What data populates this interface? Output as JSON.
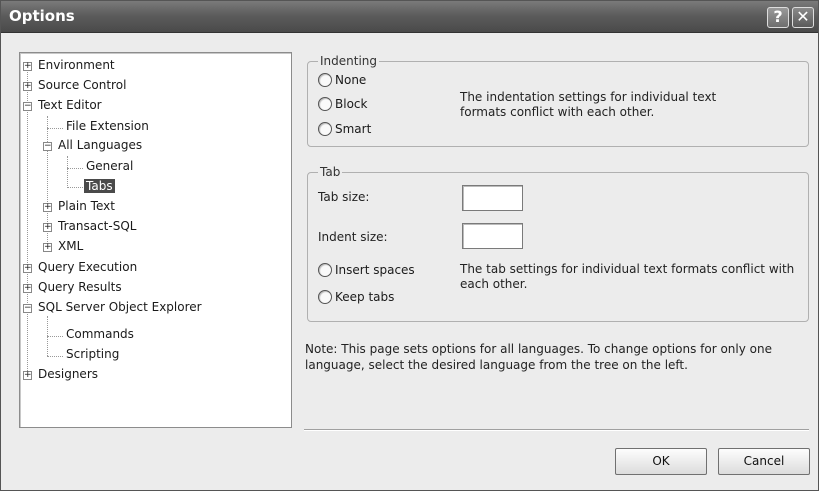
{
  "window": {
    "title": "Options",
    "help_glyph": "?",
    "close_glyph": "✕"
  },
  "tree": {
    "environment": "Environment",
    "source_control": "Source Control",
    "text_editor": "Text Editor",
    "file_extension": "File Extension",
    "all_languages": "All Languages",
    "general": "General",
    "tabs": "Tabs",
    "plain_text": "Plain Text",
    "transact_sql": "Transact-SQL",
    "xml": "XML",
    "query_execution": "Query Execution",
    "query_results": "Query Results",
    "sql_server_object_explorer": "SQL Server Object Explorer",
    "commands": "Commands",
    "scripting": "Scripting",
    "designers": "Designers",
    "selected": "Tabs"
  },
  "indenting": {
    "title": "Indenting",
    "none": "None",
    "block": "Block",
    "smart": "Smart",
    "message": "The indentation settings for individual text formats conflict with each other."
  },
  "tab": {
    "title": "Tab",
    "tab_size_label": "Tab size:",
    "tab_size_value": "",
    "indent_size_label": "Indent size:",
    "indent_size_value": "",
    "insert_spaces": "Insert spaces",
    "keep_tabs": "Keep tabs",
    "message": "The tab settings for individual text formats conflict with each other."
  },
  "note": "Note: This page sets options for all languages. To change options for only one language, select the desired language from the tree on the left.",
  "buttons": {
    "ok": "OK",
    "cancel": "Cancel"
  }
}
